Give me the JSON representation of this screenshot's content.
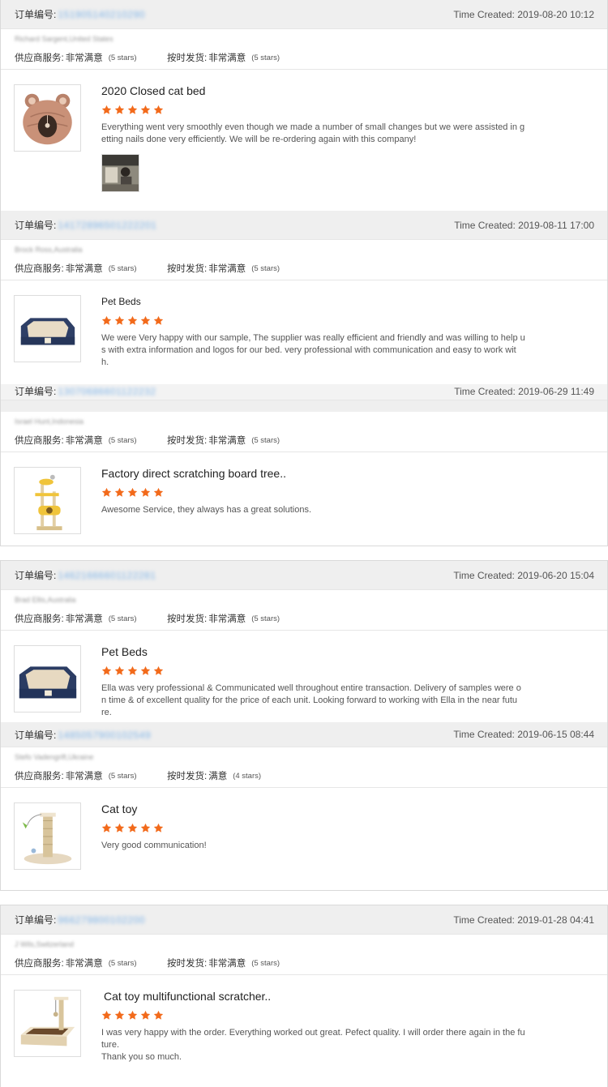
{
  "labels": {
    "order_no": "订单编号:",
    "time_prefix": "Time Created:",
    "supplier_service": "供应商服务:",
    "on_time_shipping": "按时发货:"
  },
  "accent_star_color": "#f26a1b",
  "reviews": [
    {
      "order_number": "151905140210290",
      "time_created": "2019-08-20 10:12",
      "buyer": "Richard Sargent,United States",
      "supplier_rating": "非常满意",
      "supplier_stars": "(5 stars)",
      "shipping_rating": "非常满意",
      "shipping_stars": "(5 stars)",
      "product_title": "2020 Closed cat bed",
      "product_icon": "cat-bed-icon",
      "stars": 5,
      "text": "Everything went very smoothly even though we made a number of small changes but we were assisted in g\netting nails done very efficiently. We will be re-ordering again with this company!",
      "has_photo": true
    },
    {
      "order_number": "14172896501222201",
      "time_created": "2019-08-11 17:00",
      "buyer": "Brock Ross,Australia",
      "supplier_rating": "非常满意",
      "supplier_stars": "(5 stars)",
      "shipping_rating": "非常满意",
      "shipping_stars": "(5 stars)",
      "product_title": "Pet Beds",
      "product_icon": "pet-bed-icon",
      "stars": 5,
      "text": "We were Very happy with our sample, The supplier was really efficient and friendly and was willing to help u\ns with extra information and logos for our bed. very professional with communication and easy to work wit\nh.",
      "has_photo": false
    },
    {
      "order_number": "13070686601122232",
      "time_created": "2019-06-29 11:49",
      "buyer": "Israel Hunt,Indonesia",
      "supplier_rating": "非常满意",
      "supplier_stars": "(5 stars)",
      "shipping_rating": "非常满意",
      "shipping_stars": "(5 stars)",
      "product_title": "Factory direct scratching board tree..",
      "product_icon": "cat-tree-icon",
      "stars": 5,
      "text": "Awesome Service, they always has a great solutions.",
      "has_photo": false
    },
    {
      "order_number": "14621666601122281",
      "time_created": "2019-06-20 15:04",
      "buyer": "Brad Ellis,Australia",
      "supplier_rating": "非常满意",
      "supplier_stars": "(5 stars)",
      "shipping_rating": "非常满意",
      "shipping_stars": "(5 stars)",
      "product_title": "Pet Beds",
      "product_icon": "pet-bed-icon",
      "stars": 5,
      "text": "Ella was very professional & Communicated well throughout entire transaction. Delivery of samples were o\nn time & of excellent quality for the price of each unit. Looking forward to working with Ella in the near futu\nre.",
      "has_photo": false
    },
    {
      "order_number": "1485057900102549",
      "time_created": "2019-06-15 08:44",
      "buyer": "Stefo Vadengrift,Ukraine",
      "supplier_rating": "非常满意",
      "supplier_stars": "(5 stars)",
      "shipping_rating": "满意",
      "shipping_stars": "(4 stars)",
      "product_title": "Cat toy",
      "product_icon": "cat-toy-icon",
      "stars": 5,
      "text": "Very good communication!",
      "has_photo": false
    },
    {
      "order_number": "966279800102200",
      "time_created": "2019-01-28 04:41",
      "buyer": "J Wils,Switzerland",
      "supplier_rating": "非常满意",
      "supplier_stars": "(5 stars)",
      "shipping_rating": "非常满意",
      "shipping_stars": "(5 stars)",
      "product_title": "Cat toy multifunctional scratcher..",
      "product_icon": "cat-scratcher-icon",
      "stars": 5,
      "text": "I was very happy with the order. Everything worked out great. Pefect quality. I will order there again in the fu\nture.\nThank you so much.",
      "has_photo": false
    }
  ]
}
